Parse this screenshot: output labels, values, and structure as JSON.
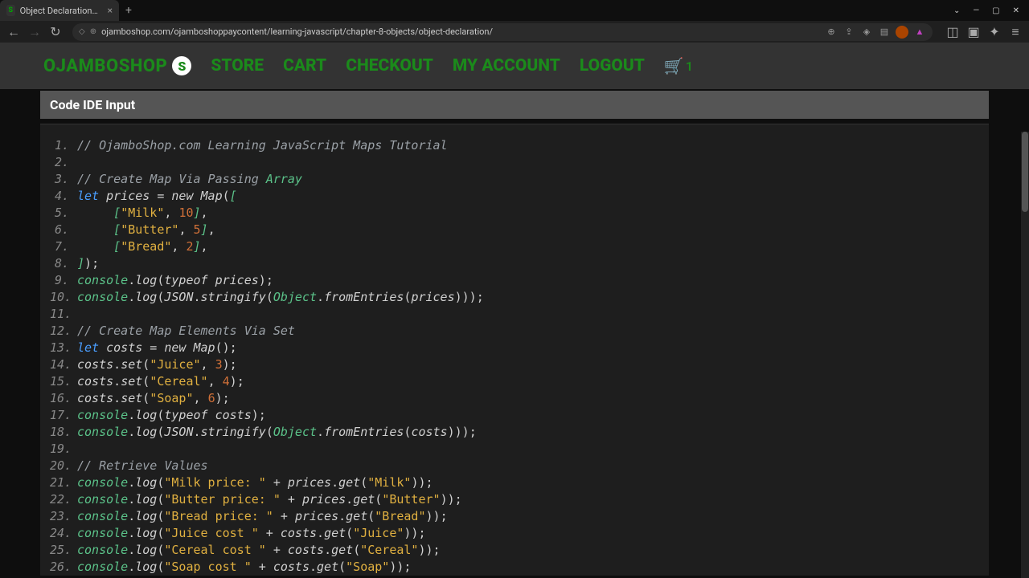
{
  "browser": {
    "tab_title": "Object Declaration - Ojamb",
    "url": "ojamboshop.com/ojamboshoppaycontent/learning-javascript/chapter-8-objects/object-declaration/"
  },
  "nav": {
    "logo": "OJAMBOSHOP",
    "logo_letter": "S",
    "items": [
      "STORE",
      "CART",
      "CHECKOUT",
      "MY ACCOUNT",
      "LOGOUT"
    ],
    "cart_count": "1"
  },
  "ide": {
    "title": "Code IDE Input"
  },
  "code_lines": [
    [
      {
        "t": "// OjamboShop.com Learning JavaScript Maps Tutorial",
        "c": "cm-comment"
      }
    ],
    [],
    [
      {
        "t": "// Create Map Via Passing ",
        "c": "cm-comment"
      },
      {
        "t": "Array",
        "c": "cm-keyword2"
      }
    ],
    [
      {
        "t": "let",
        "c": "cm-keyword"
      },
      {
        "t": " ",
        "c": ""
      },
      {
        "t": "prices = new Map",
        "c": "cm-var"
      },
      {
        "t": "(",
        "c": "cm-punct"
      },
      {
        "t": "[",
        "c": "cm-obj"
      }
    ],
    [
      {
        "t": "     ",
        "c": ""
      },
      {
        "t": "[",
        "c": "cm-obj"
      },
      {
        "t": "\"Milk\"",
        "c": "cm-string"
      },
      {
        "t": ", ",
        "c": "cm-punct"
      },
      {
        "t": "10",
        "c": "cm-number"
      },
      {
        "t": "]",
        "c": "cm-obj"
      },
      {
        "t": ",",
        "c": "cm-punct"
      }
    ],
    [
      {
        "t": "     ",
        "c": ""
      },
      {
        "t": "[",
        "c": "cm-obj"
      },
      {
        "t": "\"Butter\"",
        "c": "cm-string"
      },
      {
        "t": ", ",
        "c": "cm-punct"
      },
      {
        "t": "5",
        "c": "cm-number"
      },
      {
        "t": "]",
        "c": "cm-obj"
      },
      {
        "t": ",",
        "c": "cm-punct"
      }
    ],
    [
      {
        "t": "     ",
        "c": ""
      },
      {
        "t": "[",
        "c": "cm-obj"
      },
      {
        "t": "\"Bread\"",
        "c": "cm-string"
      },
      {
        "t": ", ",
        "c": "cm-punct"
      },
      {
        "t": "2",
        "c": "cm-number"
      },
      {
        "t": "]",
        "c": "cm-obj"
      },
      {
        "t": ",",
        "c": "cm-punct"
      }
    ],
    [
      {
        "t": "]",
        "c": "cm-obj"
      },
      {
        "t": ")",
        "c": "cm-punct"
      },
      {
        "t": ";",
        "c": "cm-punct"
      }
    ],
    [
      {
        "t": "console",
        "c": "cm-obj"
      },
      {
        "t": ".",
        "c": "cm-punct"
      },
      {
        "t": "log",
        "c": "cm-prop"
      },
      {
        "t": "(",
        "c": "cm-punct"
      },
      {
        "t": "typeof prices",
        "c": "cm-var"
      },
      {
        "t": ")",
        "c": "cm-punct"
      },
      {
        "t": ";",
        "c": "cm-punct"
      }
    ],
    [
      {
        "t": "console",
        "c": "cm-obj"
      },
      {
        "t": ".",
        "c": "cm-punct"
      },
      {
        "t": "log",
        "c": "cm-prop"
      },
      {
        "t": "(",
        "c": "cm-punct"
      },
      {
        "t": "JSON",
        "c": "cm-var"
      },
      {
        "t": ".",
        "c": "cm-punct"
      },
      {
        "t": "stringify",
        "c": "cm-prop"
      },
      {
        "t": "(",
        "c": "cm-punct"
      },
      {
        "t": "Object",
        "c": "cm-keyword2"
      },
      {
        "t": ".",
        "c": "cm-punct"
      },
      {
        "t": "fromEntries",
        "c": "cm-prop"
      },
      {
        "t": "(",
        "c": "cm-punct"
      },
      {
        "t": "prices",
        "c": "cm-var"
      },
      {
        "t": ")))",
        "c": "cm-punct"
      },
      {
        "t": ";",
        "c": "cm-punct"
      }
    ],
    [],
    [
      {
        "t": "// Create Map Elements Via Set",
        "c": "cm-comment"
      }
    ],
    [
      {
        "t": "let",
        "c": "cm-keyword"
      },
      {
        "t": " ",
        "c": ""
      },
      {
        "t": "costs = new Map",
        "c": "cm-var"
      },
      {
        "t": "()",
        "c": "cm-punct"
      },
      {
        "t": ";",
        "c": "cm-punct"
      }
    ],
    [
      {
        "t": "costs",
        "c": "cm-var"
      },
      {
        "t": ".",
        "c": "cm-punct"
      },
      {
        "t": "set",
        "c": "cm-prop"
      },
      {
        "t": "(",
        "c": "cm-punct"
      },
      {
        "t": "\"Juice\"",
        "c": "cm-string"
      },
      {
        "t": ", ",
        "c": "cm-punct"
      },
      {
        "t": "3",
        "c": "cm-number"
      },
      {
        "t": ")",
        "c": "cm-punct"
      },
      {
        "t": ";",
        "c": "cm-punct"
      }
    ],
    [
      {
        "t": "costs",
        "c": "cm-var"
      },
      {
        "t": ".",
        "c": "cm-punct"
      },
      {
        "t": "set",
        "c": "cm-prop"
      },
      {
        "t": "(",
        "c": "cm-punct"
      },
      {
        "t": "\"Cereal\"",
        "c": "cm-string"
      },
      {
        "t": ", ",
        "c": "cm-punct"
      },
      {
        "t": "4",
        "c": "cm-number"
      },
      {
        "t": ")",
        "c": "cm-punct"
      },
      {
        "t": ";",
        "c": "cm-punct"
      }
    ],
    [
      {
        "t": "costs",
        "c": "cm-var"
      },
      {
        "t": ".",
        "c": "cm-punct"
      },
      {
        "t": "set",
        "c": "cm-prop"
      },
      {
        "t": "(",
        "c": "cm-punct"
      },
      {
        "t": "\"Soap\"",
        "c": "cm-string"
      },
      {
        "t": ", ",
        "c": "cm-punct"
      },
      {
        "t": "6",
        "c": "cm-number"
      },
      {
        "t": ")",
        "c": "cm-punct"
      },
      {
        "t": ";",
        "c": "cm-punct"
      }
    ],
    [
      {
        "t": "console",
        "c": "cm-obj"
      },
      {
        "t": ".",
        "c": "cm-punct"
      },
      {
        "t": "log",
        "c": "cm-prop"
      },
      {
        "t": "(",
        "c": "cm-punct"
      },
      {
        "t": "typeof costs",
        "c": "cm-var"
      },
      {
        "t": ")",
        "c": "cm-punct"
      },
      {
        "t": ";",
        "c": "cm-punct"
      }
    ],
    [
      {
        "t": "console",
        "c": "cm-obj"
      },
      {
        "t": ".",
        "c": "cm-punct"
      },
      {
        "t": "log",
        "c": "cm-prop"
      },
      {
        "t": "(",
        "c": "cm-punct"
      },
      {
        "t": "JSON",
        "c": "cm-var"
      },
      {
        "t": ".",
        "c": "cm-punct"
      },
      {
        "t": "stringify",
        "c": "cm-prop"
      },
      {
        "t": "(",
        "c": "cm-punct"
      },
      {
        "t": "Object",
        "c": "cm-keyword2"
      },
      {
        "t": ".",
        "c": "cm-punct"
      },
      {
        "t": "fromEntries",
        "c": "cm-prop"
      },
      {
        "t": "(",
        "c": "cm-punct"
      },
      {
        "t": "costs",
        "c": "cm-var"
      },
      {
        "t": ")))",
        "c": "cm-punct"
      },
      {
        "t": ";",
        "c": "cm-punct"
      }
    ],
    [],
    [
      {
        "t": "// Retrieve Values",
        "c": "cm-comment"
      }
    ],
    [
      {
        "t": "console",
        "c": "cm-obj"
      },
      {
        "t": ".",
        "c": "cm-punct"
      },
      {
        "t": "log",
        "c": "cm-prop"
      },
      {
        "t": "(",
        "c": "cm-punct"
      },
      {
        "t": "\"Milk price: \"",
        "c": "cm-string"
      },
      {
        "t": " + ",
        "c": "cm-punct"
      },
      {
        "t": "prices",
        "c": "cm-var"
      },
      {
        "t": ".",
        "c": "cm-punct"
      },
      {
        "t": "get",
        "c": "cm-prop"
      },
      {
        "t": "(",
        "c": "cm-punct"
      },
      {
        "t": "\"Milk\"",
        "c": "cm-string"
      },
      {
        "t": "))",
        "c": "cm-punct"
      },
      {
        "t": ";",
        "c": "cm-punct"
      }
    ],
    [
      {
        "t": "console",
        "c": "cm-obj"
      },
      {
        "t": ".",
        "c": "cm-punct"
      },
      {
        "t": "log",
        "c": "cm-prop"
      },
      {
        "t": "(",
        "c": "cm-punct"
      },
      {
        "t": "\"Butter price: \"",
        "c": "cm-string"
      },
      {
        "t": " + ",
        "c": "cm-punct"
      },
      {
        "t": "prices",
        "c": "cm-var"
      },
      {
        "t": ".",
        "c": "cm-punct"
      },
      {
        "t": "get",
        "c": "cm-prop"
      },
      {
        "t": "(",
        "c": "cm-punct"
      },
      {
        "t": "\"Butter\"",
        "c": "cm-string"
      },
      {
        "t": "))",
        "c": "cm-punct"
      },
      {
        "t": ";",
        "c": "cm-punct"
      }
    ],
    [
      {
        "t": "console",
        "c": "cm-obj"
      },
      {
        "t": ".",
        "c": "cm-punct"
      },
      {
        "t": "log",
        "c": "cm-prop"
      },
      {
        "t": "(",
        "c": "cm-punct"
      },
      {
        "t": "\"Bread price: \"",
        "c": "cm-string"
      },
      {
        "t": " + ",
        "c": "cm-punct"
      },
      {
        "t": "prices",
        "c": "cm-var"
      },
      {
        "t": ".",
        "c": "cm-punct"
      },
      {
        "t": "get",
        "c": "cm-prop"
      },
      {
        "t": "(",
        "c": "cm-punct"
      },
      {
        "t": "\"Bread\"",
        "c": "cm-string"
      },
      {
        "t": "))",
        "c": "cm-punct"
      },
      {
        "t": ";",
        "c": "cm-punct"
      }
    ],
    [
      {
        "t": "console",
        "c": "cm-obj"
      },
      {
        "t": ".",
        "c": "cm-punct"
      },
      {
        "t": "log",
        "c": "cm-prop"
      },
      {
        "t": "(",
        "c": "cm-punct"
      },
      {
        "t": "\"Juice cost \"",
        "c": "cm-string"
      },
      {
        "t": " + ",
        "c": "cm-punct"
      },
      {
        "t": "costs",
        "c": "cm-var"
      },
      {
        "t": ".",
        "c": "cm-punct"
      },
      {
        "t": "get",
        "c": "cm-prop"
      },
      {
        "t": "(",
        "c": "cm-punct"
      },
      {
        "t": "\"Juice\"",
        "c": "cm-string"
      },
      {
        "t": "))",
        "c": "cm-punct"
      },
      {
        "t": ";",
        "c": "cm-punct"
      }
    ],
    [
      {
        "t": "console",
        "c": "cm-obj"
      },
      {
        "t": ".",
        "c": "cm-punct"
      },
      {
        "t": "log",
        "c": "cm-prop"
      },
      {
        "t": "(",
        "c": "cm-punct"
      },
      {
        "t": "\"Cereal cost \"",
        "c": "cm-string"
      },
      {
        "t": " + ",
        "c": "cm-punct"
      },
      {
        "t": "costs",
        "c": "cm-var"
      },
      {
        "t": ".",
        "c": "cm-punct"
      },
      {
        "t": "get",
        "c": "cm-prop"
      },
      {
        "t": "(",
        "c": "cm-punct"
      },
      {
        "t": "\"Cereal\"",
        "c": "cm-string"
      },
      {
        "t": "))",
        "c": "cm-punct"
      },
      {
        "t": ";",
        "c": "cm-punct"
      }
    ],
    [
      {
        "t": "console",
        "c": "cm-obj"
      },
      {
        "t": ".",
        "c": "cm-punct"
      },
      {
        "t": "log",
        "c": "cm-prop"
      },
      {
        "t": "(",
        "c": "cm-punct"
      },
      {
        "t": "\"Soap cost \"",
        "c": "cm-string"
      },
      {
        "t": " + ",
        "c": "cm-punct"
      },
      {
        "t": "costs",
        "c": "cm-var"
      },
      {
        "t": ".",
        "c": "cm-punct"
      },
      {
        "t": "get",
        "c": "cm-prop"
      },
      {
        "t": "(",
        "c": "cm-punct"
      },
      {
        "t": "\"Soap\"",
        "c": "cm-string"
      },
      {
        "t": "))",
        "c": "cm-punct"
      },
      {
        "t": ";",
        "c": "cm-punct"
      }
    ]
  ]
}
